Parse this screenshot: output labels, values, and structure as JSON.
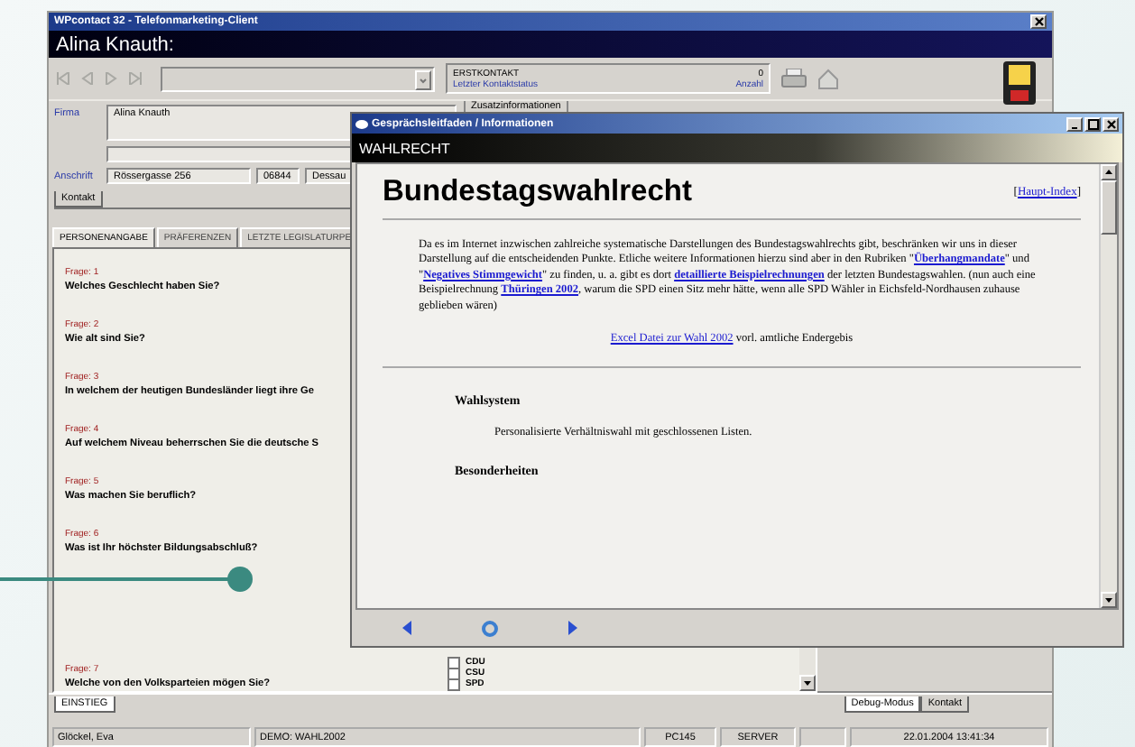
{
  "main_window": {
    "title": "WPcontact 32 - Telefonmarketing-Client",
    "contact_name": "Alina Knauth:",
    "status_box": {
      "status": "ERSTKONTAKT",
      "status_label": "Letzter Kontaktstatus",
      "count": "0",
      "count_label": "Anzahl"
    },
    "company": {
      "label": "Firma",
      "value": "Alina Knauth"
    },
    "extra_tab": "Zusatzinformationen",
    "address": {
      "label": "Anschrift",
      "street": "Rössergasse 256",
      "zip": "06844",
      "city": "Dessau"
    },
    "contact_tab": "Kontakt",
    "tabs": [
      {
        "label": "PERSONENANGABE",
        "selected": true
      },
      {
        "label": "PRÄFERENZEN",
        "selected": false
      },
      {
        "label": "LETZTE LEGISLATURPE",
        "selected": false
      }
    ],
    "questions": [
      {
        "number": "Frage: 1",
        "text": "Welches Geschlecht haben Sie?"
      },
      {
        "number": "Frage: 2",
        "text": "Wie alt sind Sie?"
      },
      {
        "number": "Frage: 3",
        "text": "In welchem der heutigen Bundesländer liegt ihre Ge"
      },
      {
        "number": "Frage: 4",
        "text": "Auf welchem Niveau beherrschen Sie die deutsche S"
      },
      {
        "number": "Frage: 5",
        "text": "Was machen Sie beruflich?"
      },
      {
        "number": "Frage: 6",
        "text": "Was ist Ihr höchster Bildungsabschluß?"
      },
      {
        "number": "Frage: 7",
        "text": "Welche von den Volksparteien mögen Sie?"
      }
    ],
    "options": [
      {
        "label": "CDU",
        "checked": false
      },
      {
        "label": "CSU",
        "checked": false
      },
      {
        "label": "SPD",
        "checked": false
      }
    ],
    "bottom_tabs": [
      {
        "label": "EINSTIEG",
        "selected": true
      }
    ],
    "right_tabs": [
      {
        "label": "Debug-Modus",
        "selected": true
      },
      {
        "label": "Kontakt",
        "selected": false
      }
    ],
    "status_bar": [
      "Glöckel, Eva",
      "DEMO: WAHL2002",
      "PC145",
      "SERVER",
      "22.01.2004 13:41:34"
    ]
  },
  "info_window": {
    "title": "Gesprächsleitfaden / Informationen",
    "header": "WAHLRECHT",
    "heading": "Bundestagswahlrecht",
    "index_link": {
      "before": "[",
      "link": "Haupt-Index",
      "after": "]"
    },
    "paragraph": [
      {
        "text": "Da es im Internet inzwischen zahlreiche systematische Darstellungen des Bundestagswahlrechts gibt, beschränken wir uns in dieser Darstellung auf die entscheidenden Punkte. Etliche weitere Informationen hierzu sind aber in den Rubriken \"",
        "link": false
      },
      {
        "text": "Überhangmandate",
        "link": true
      },
      {
        "text": "\" und \"",
        "link": false
      },
      {
        "text": "Negatives Stimmgewicht",
        "link": true
      },
      {
        "text": "\" zu finden, u. a. gibt es dort ",
        "link": false
      },
      {
        "text": "detaillierte Beispielrechnungen",
        "link": true
      },
      {
        "text": " der letzten Bundestagswahlen. (nun auch eine Beispielrechnung ",
        "link": false
      },
      {
        "text": "Thüringen 2002",
        "link": true
      },
      {
        "text": ", warum die SPD einen Sitz mehr hätte, wenn alle SPD Wähler in Eichsfeld-Nordhausen zuhause geblieben wären)",
        "link": false
      }
    ],
    "excel_line": {
      "link": "Excel Datei zur Wahl 2002",
      "after": " vorl. amtliche Endergebis"
    },
    "sections": [
      {
        "heading": "Wahlsystem",
        "text": "Personalisierte Verhältniswahl mit geschlossenen Listen."
      },
      {
        "heading": "Besonderheiten"
      }
    ]
  }
}
